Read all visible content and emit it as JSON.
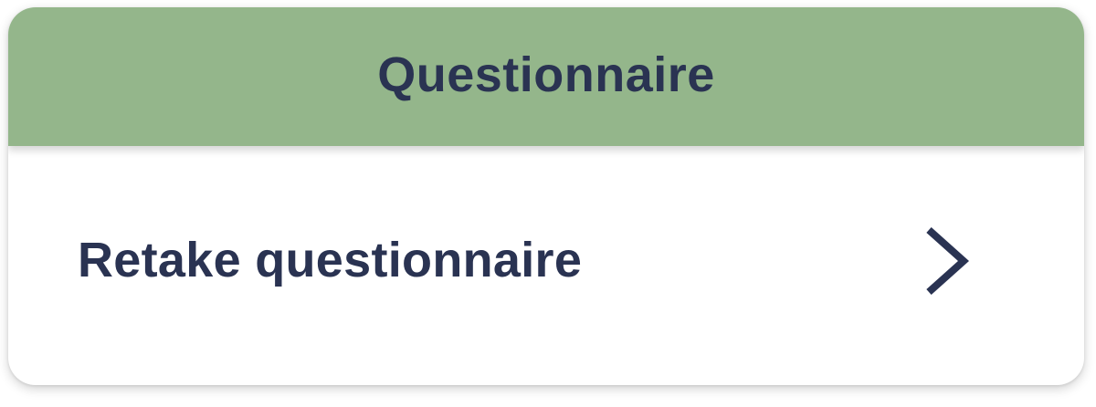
{
  "card": {
    "title": "Questionnaire",
    "row_label": "Retake questionnaire",
    "row_icon": "chevron-right-icon"
  },
  "colors": {
    "header_background": "#94b68b",
    "text": "#2a3352",
    "card_background": "#ffffff"
  }
}
